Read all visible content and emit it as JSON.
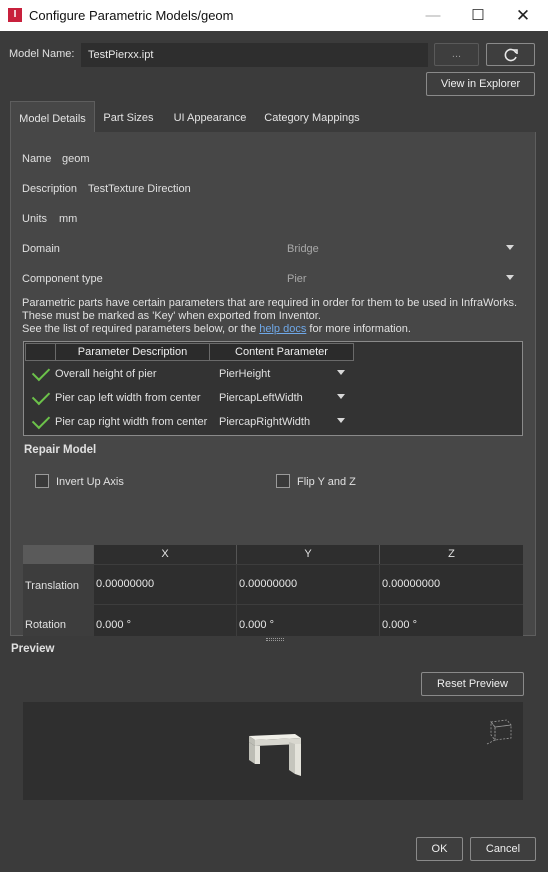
{
  "window": {
    "title": "Configure Parametric Models/geom",
    "app_icon_letter": "I",
    "minimize_glyph": "—",
    "maximize_glyph": "☐",
    "close_glyph": "✕"
  },
  "model": {
    "label": "Model Name:",
    "value": "TestPierxx.ipt",
    "browse_label": "...",
    "refresh_icon": "refresh-icon",
    "explorer_label": "View in Explorer"
  },
  "tabs": [
    {
      "label": "Model Details",
      "active": true
    },
    {
      "label": "Part Sizes",
      "active": false
    },
    {
      "label": "UI Appearance",
      "active": false
    },
    {
      "label": "Category Mappings",
      "active": false
    }
  ],
  "details": {
    "name_label": "Name",
    "name_value": "geom",
    "description_label": "Description",
    "description_value": "TestTexture Direction",
    "units_label": "Units",
    "units_value": "mm",
    "domain_label": "Domain",
    "domain_value": "Bridge",
    "component_label": "Component type",
    "component_value": "Pier"
  },
  "info": {
    "line1": "Parametric parts have certain parameters that are required in order for them to be used in InfraWorks.",
    "line2": "These must be marked as 'Key' when exported from Inventor.",
    "line3_prefix": "See the list of required parameters below, or the ",
    "link": "help docs",
    "line3_suffix": " for more information."
  },
  "parameters": {
    "headers": [
      "Parameter Description",
      "Content Parameter"
    ],
    "rows": [
      {
        "description": "Overall height of pier",
        "content": "PierHeight",
        "valid": true
      },
      {
        "description": "Pier cap left width from center",
        "content": "PiercapLeftWidth",
        "valid": true
      },
      {
        "description": "Pier cap right width from center",
        "content": "PiercapRightWidth",
        "valid": true
      }
    ]
  },
  "repair": {
    "title": "Repair Model",
    "invert_up_axis": {
      "label": "Invert Up Axis",
      "checked": false
    },
    "flip_yz": {
      "label": "Flip Y and Z",
      "checked": false
    }
  },
  "transform": {
    "columns": [
      "X",
      "Y",
      "Z"
    ],
    "rows": [
      {
        "label": "Translation",
        "values": [
          "0.00000000",
          "0.00000000",
          "0.00000000"
        ]
      },
      {
        "label": "Rotation",
        "values": [
          "0.000 °",
          "0.000 °",
          "0.000 °"
        ]
      }
    ]
  },
  "preview": {
    "title": "Preview",
    "reset_label": "Reset Preview"
  },
  "footer": {
    "ok_label": "OK",
    "cancel_label": "Cancel"
  },
  "colors": {
    "background": "#3b3b3b",
    "panel": "#474747",
    "field": "#2e2e2e",
    "check": "#6cc24a",
    "link": "#6fa8e8",
    "app_icon": "#c8203c"
  }
}
